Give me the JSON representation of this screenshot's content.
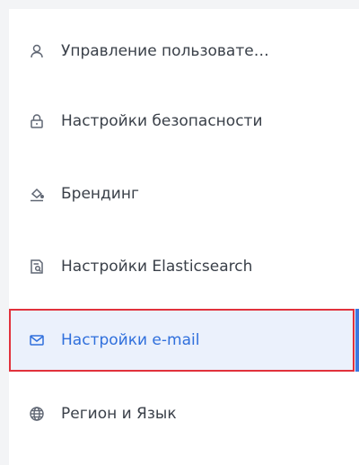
{
  "sidebar": {
    "items": [
      {
        "label": "Управление пользовате…",
        "icon": "user-icon"
      },
      {
        "label": "Настройки безопасности",
        "icon": "lock-icon"
      },
      {
        "label": "Брендинг",
        "icon": "paint-bucket-icon"
      },
      {
        "label": "Настройки Elasticsearch",
        "icon": "search-document-icon"
      },
      {
        "label": "Настройки e-mail",
        "icon": "mail-icon",
        "active": true
      },
      {
        "label": "Регион и Язык",
        "icon": "globe-icon"
      }
    ],
    "active_color": "#2f6fdc",
    "highlight_color": "#e1313c"
  }
}
